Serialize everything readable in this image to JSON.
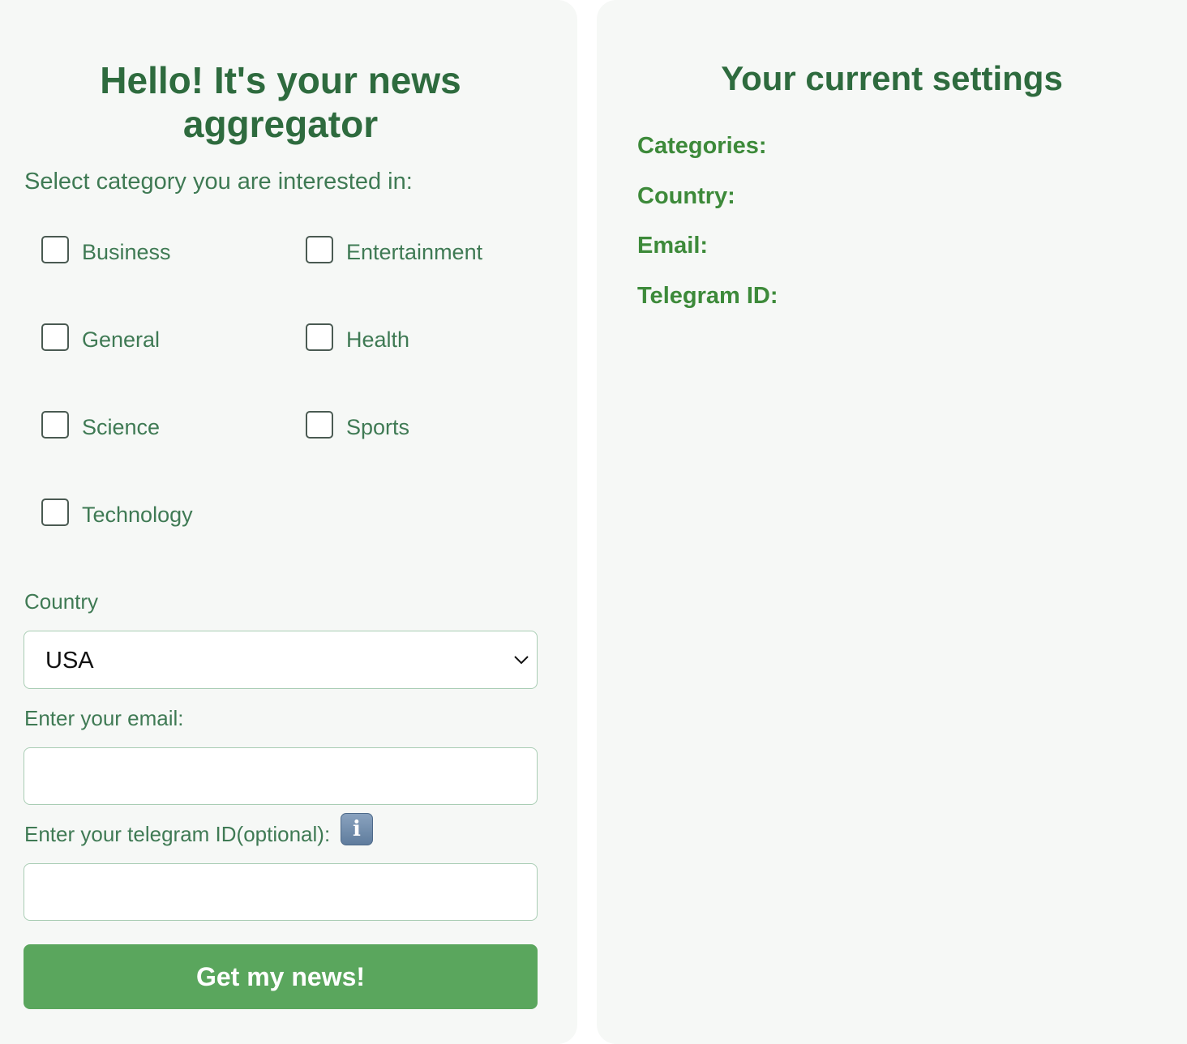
{
  "left_panel": {
    "title": "Hello! It's your news aggregator",
    "prompt": "Select category you are interested in:",
    "categories": [
      {
        "label": "Business",
        "checked": false
      },
      {
        "label": "Entertainment",
        "checked": false
      },
      {
        "label": "General",
        "checked": false
      },
      {
        "label": "Health",
        "checked": false
      },
      {
        "label": "Science",
        "checked": false
      },
      {
        "label": "Sports",
        "checked": false
      },
      {
        "label": "Technology",
        "checked": false
      }
    ],
    "country": {
      "label": "Country",
      "selected": "USA"
    },
    "email": {
      "label": "Enter your email:",
      "value": ""
    },
    "telegram": {
      "label": "Enter your telegram ID(optional):",
      "value": "",
      "info_icon": "info-icon"
    },
    "submit_label": "Get my news!"
  },
  "right_panel": {
    "title": "Your current settings",
    "rows": [
      {
        "label": "Categories:"
      },
      {
        "label": "Country:"
      },
      {
        "label": "Email:"
      },
      {
        "label": "Telegram ID:"
      }
    ]
  },
  "colors": {
    "panel_bg": "#f6f8f6",
    "title_green": "#2e6b3e",
    "label_green": "#3f7a54",
    "settings_green": "#3d8a3a",
    "button_green": "#5aa65d",
    "input_border": "#a9cdb4"
  }
}
